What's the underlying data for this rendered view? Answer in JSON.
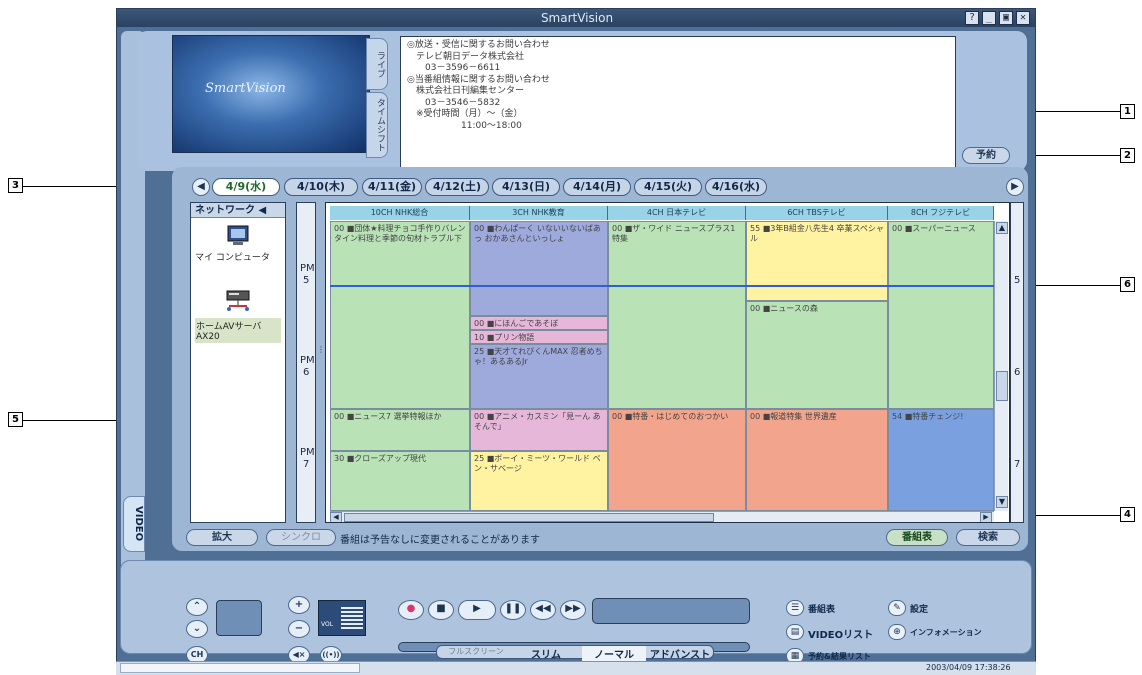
{
  "window": {
    "title": "SmartVision",
    "help_btn": "?",
    "min_btn": "_",
    "restore_btn": "▣",
    "close_btn": "✕"
  },
  "preview": {
    "logo": "SmartVision"
  },
  "side_tabs": {
    "live": "ライブ",
    "timeshift": "タイムシフト",
    "video": "VIDEO"
  },
  "info_lines": [
    "◎放送・受信に関するお問い合わせ",
    "　テレビ朝日データ株式会社",
    "　　03－3596－6611",
    "◎当番組情報に関するお問い合わせ",
    "　株式会社日刊編集センター",
    "　　03－3546－5832",
    "　※受付時間（月）～（金）",
    "　　　　　　11:00～18:00"
  ],
  "buttons": {
    "reserve": "予約",
    "enlarge": "拡大",
    "sync": "シンクロ",
    "program_table": "番組表",
    "search": "検索"
  },
  "notice": "番組は予告なしに変更されることがあります",
  "dates": [
    "4/9(水)",
    "4/10(木)",
    "4/11(金)",
    "4/12(土)",
    "4/13(日)",
    "4/14(月)",
    "4/15(火)",
    "4/16(水)"
  ],
  "network": {
    "header": "ネットワーク ◀",
    "items": [
      {
        "label": "マイ コンピュータ",
        "icon": "computer-icon"
      },
      {
        "label": "ホームAVサーバ\nAX20",
        "icon": "av-server-icon"
      }
    ]
  },
  "times": [
    {
      "ampm": "PM",
      "hour": "5"
    },
    {
      "ampm": "PM",
      "hour": "6"
    },
    {
      "ampm": "PM",
      "hour": "7"
    }
  ],
  "channels": [
    "10CH NHK総合",
    "3CH NHK教育",
    "4CH 日本テレビ",
    "6CH TBSテレビ",
    "8CH フジテレビ"
  ],
  "programs": [
    {
      "ch": 0,
      "text": "00 ■団体★料理チョコ手作りバレンタイン料理と季節の旬材トラブル下",
      "color": "#b9e2b7"
    },
    {
      "ch": 0,
      "text": "00 ■ニュース7 選挙特報ほか",
      "color": "#b9e2b7"
    },
    {
      "ch": 0,
      "text": "30 ■クローズアップ現代",
      "color": "#b9e2b7"
    },
    {
      "ch": 1,
      "text": "00 ■わんぱーく いないいないばあっ おかあさんといっしょ",
      "color": "#9ea9dc"
    },
    {
      "ch": 1,
      "text": "00 ■にほんごであそぼ",
      "color": "#e6b7d8"
    },
    {
      "ch": 1,
      "text": "10 ■プリン物語",
      "color": "#e6b7d8"
    },
    {
      "ch": 1,
      "text": "25 ■天才てれびくんMAX 忍者めちゃ！あるあるJr",
      "color": "#9ea9dc"
    },
    {
      "ch": 1,
      "text": "00 ■アニメ・カスミン「見ーん あそんで」",
      "color": "#e6b7d8"
    },
    {
      "ch": 1,
      "text": "25 ■ボーイ・ミーツ・ワールド ベン・サベージ",
      "color": "#fff2a0"
    },
    {
      "ch": 2,
      "text": "00 ■ザ・ワイド ニュースプラス1 特集",
      "color": "#b9e2b7"
    },
    {
      "ch": 2,
      "text": "00 ■特番・はじめてのおつかい",
      "color": "#f2a58c"
    },
    {
      "ch": 3,
      "text": "55 ■3年B組金八先生4 卒業スペシャル",
      "color": "#fff2a0"
    },
    {
      "ch": 3,
      "text": "00 ■ニュースの森",
      "color": "#b9e2b7"
    },
    {
      "ch": 3,
      "text": "00 ■報道特集 世界遺産",
      "color": "#f2a58c"
    },
    {
      "ch": 4,
      "text": "00 ■スーパーニュース",
      "color": "#b9e2b7"
    },
    {
      "ch": 4,
      "text": "54 ■特番チェンジ!",
      "color": "#7aa0e0"
    }
  ],
  "controls": {
    "ch_label": "CH",
    "vol_label": "VOL",
    "nav": {
      "program_table": "番組表",
      "settings": "設定",
      "video_list": "VIDEOリスト",
      "information": "インフォメーション",
      "reserve_results": "予約&結果リスト"
    },
    "modes": [
      "フルスクリーン",
      "スリム",
      "ノーマル",
      "アドバンスト"
    ]
  },
  "status": {
    "datetime": "2003/04/09 17:38:26"
  },
  "callouts": [
    "1",
    "2",
    "3",
    "4",
    "5",
    "6"
  ]
}
